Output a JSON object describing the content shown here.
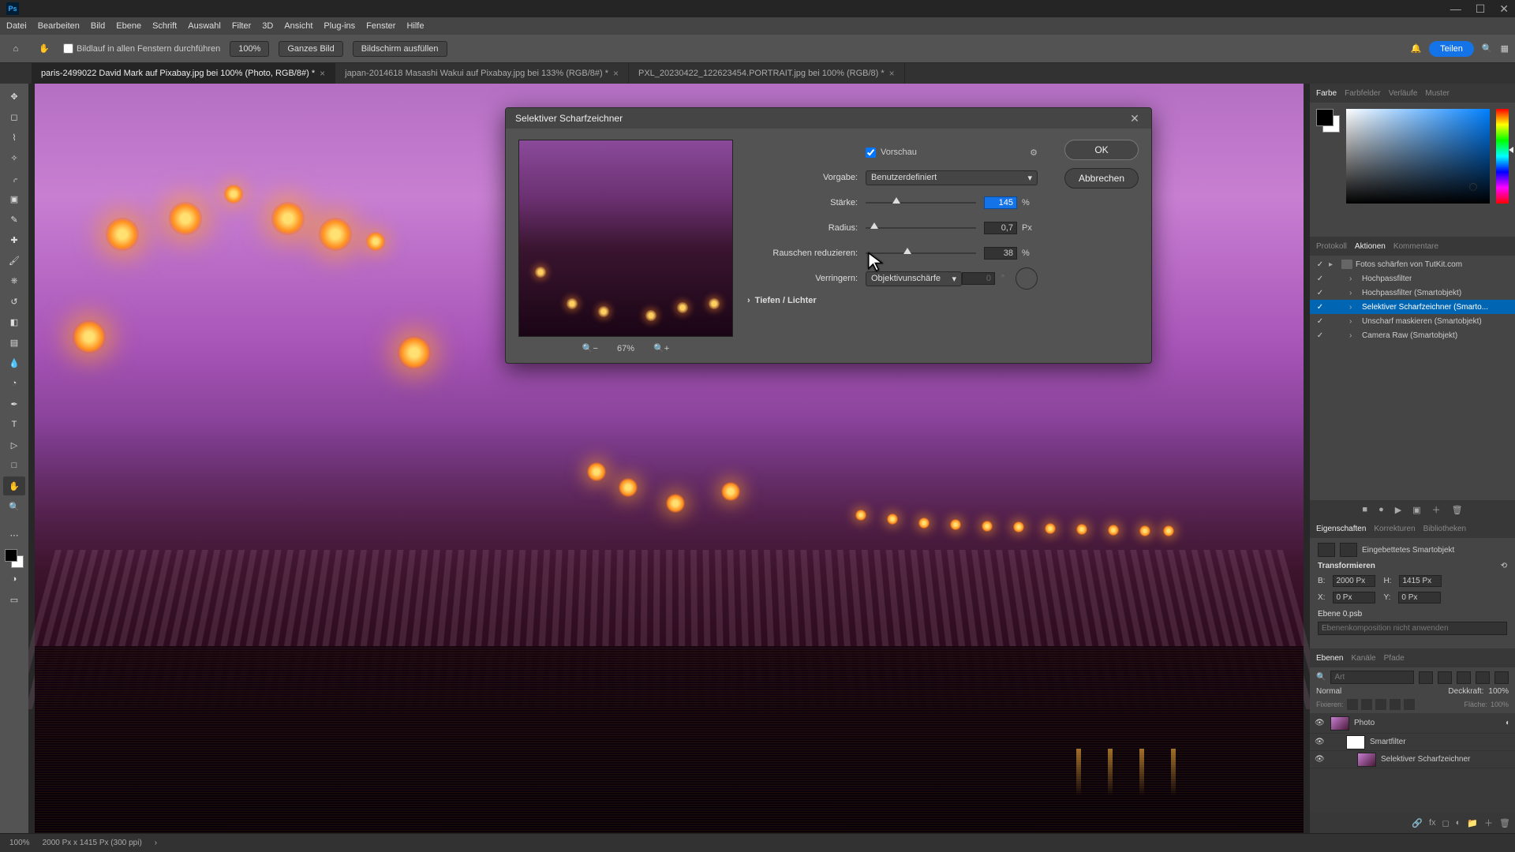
{
  "menu": [
    "Datei",
    "Bearbeiten",
    "Bild",
    "Ebene",
    "Schrift",
    "Auswahl",
    "Filter",
    "3D",
    "Ansicht",
    "Plug-ins",
    "Fenster",
    "Hilfe"
  ],
  "options": {
    "scroll_all": "Bildlauf in allen Fenstern durchführen",
    "zoom": "100%",
    "fit": "Ganzes Bild",
    "fill": "Bildschirm ausfüllen",
    "share": "Teilen"
  },
  "tabs": [
    {
      "label": "paris-2499022  David Mark auf Pixabay.jpg bei 100% (Photo, RGB/8#) *",
      "active": true
    },
    {
      "label": "japan-2014618 Masashi Wakui auf Pixabay.jpg bei 133% (RGB/8#) *",
      "active": false
    },
    {
      "label": "PXL_20230422_122623454.PORTRAIT.jpg bei 100% (RGB/8) *",
      "active": false
    }
  ],
  "dialog": {
    "title": "Selektiver Scharfzeichner",
    "preview_label": "Vorschau",
    "preset_label": "Vorgabe:",
    "preset_value": "Benutzerdefiniert",
    "amount_label": "Stärke:",
    "amount_value": "145",
    "radius_label": "Radius:",
    "radius_value": "0,7",
    "noise_label": "Rauschen reduzieren:",
    "noise_value": "38",
    "remove_label": "Verringern:",
    "remove_value": "Objektivunschärfe",
    "angle_value": "0",
    "shadows": "Tiefen / Lichter",
    "ok": "OK",
    "cancel": "Abbrechen",
    "zoom": "67%",
    "unit_pct": "%",
    "unit_px": "Px"
  },
  "panels": {
    "color_tabs": [
      "Farbe",
      "Farbfelder",
      "Verläufe",
      "Muster"
    ],
    "actions_tabs": [
      "Protokoll",
      "Aktionen",
      "Kommentare"
    ],
    "actions": [
      {
        "label": "Fotos schärfen von TutKit.com",
        "folder": true,
        "sel": false
      },
      {
        "label": "Hochpassfilter",
        "sel": false
      },
      {
        "label": "Hochpassfilter (Smartobjekt)",
        "sel": false
      },
      {
        "label": "Selektiver Scharfzeichner (Smarto...",
        "sel": true
      },
      {
        "label": "Unscharf maskieren (Smartobjekt)",
        "sel": false
      },
      {
        "label": "Camera Raw (Smartobjekt)",
        "sel": false
      }
    ],
    "props_tabs": [
      "Eigenschaften",
      "Korrekturen",
      "Bibliotheken"
    ],
    "props": {
      "type": "Eingebettetes Smartobjekt",
      "transform": "Transformieren",
      "w_lbl": "B:",
      "w": "2000 Px",
      "h_lbl": "H:",
      "h": "1415 Px",
      "x_lbl": "X:",
      "x": "0 Px",
      "y_lbl": "Y:",
      "y": "0 Px",
      "source": "Ebene 0.psb",
      "embed_comp": "Ebenenkomposition nicht anwenden"
    },
    "layers_tabs": [
      "Ebenen",
      "Kanäle",
      "Pfade"
    ],
    "layers": {
      "search_ph": "Art",
      "blend": "Normal",
      "opacity_lbl": "Deckkraft:",
      "opacity": "100%",
      "lock_lbl": "Fixieren:",
      "fill_lbl": "Fläche:",
      "fill": "100%",
      "items": [
        {
          "label": "Photo",
          "smart": true
        },
        {
          "label": "Smartfilter",
          "indent": 1
        },
        {
          "label": "Selektiver Scharfzeichner",
          "indent": 2
        }
      ]
    }
  },
  "status": {
    "zoom": "100%",
    "dims": "2000 Px x 1415 Px (300 ppi)"
  }
}
